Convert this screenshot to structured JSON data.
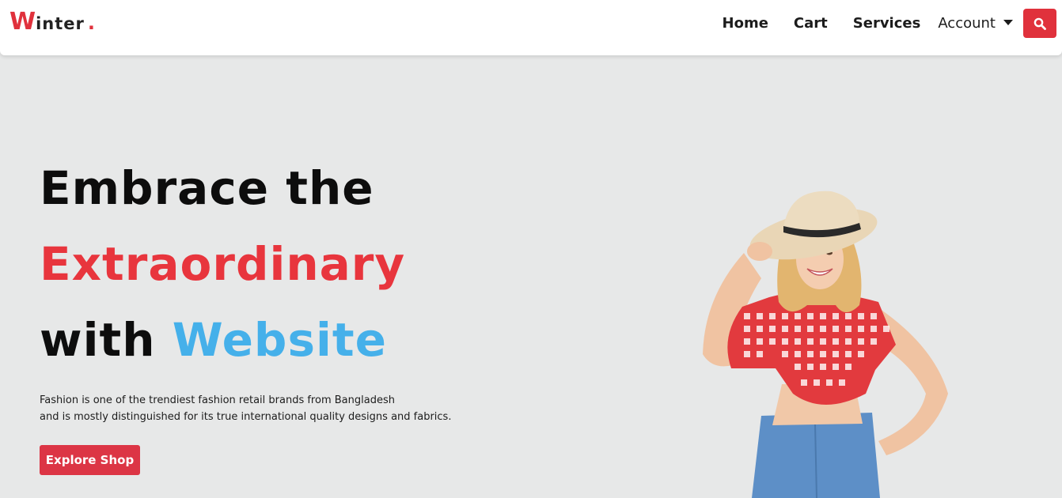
{
  "brand": {
    "initial": "W",
    "rest": "inter",
    "dot": ".",
    "accent_color": "#e0313c"
  },
  "nav": {
    "links": [
      {
        "label": "Home"
      },
      {
        "label": "Cart"
      },
      {
        "label": "Services"
      },
      {
        "label": "Account"
      }
    ],
    "search_icon": "search-icon"
  },
  "hero": {
    "line1": "Embrace the",
    "line2": "Extraordinary",
    "line3_prefix": "with",
    "line3_highlight": "Website",
    "description_line1": "Fashion is one of the trendiest fashion retail brands from Bangladesh",
    "description_line2": "and is mostly distinguished for its true international quality designs and fabrics.",
    "cta_label": "Explore Shop",
    "red_accent": "#e8353d",
    "blue_accent": "#45b0ea"
  },
  "image": {
    "subject": "smiling woman in straw hat and red gingham shirt"
  }
}
